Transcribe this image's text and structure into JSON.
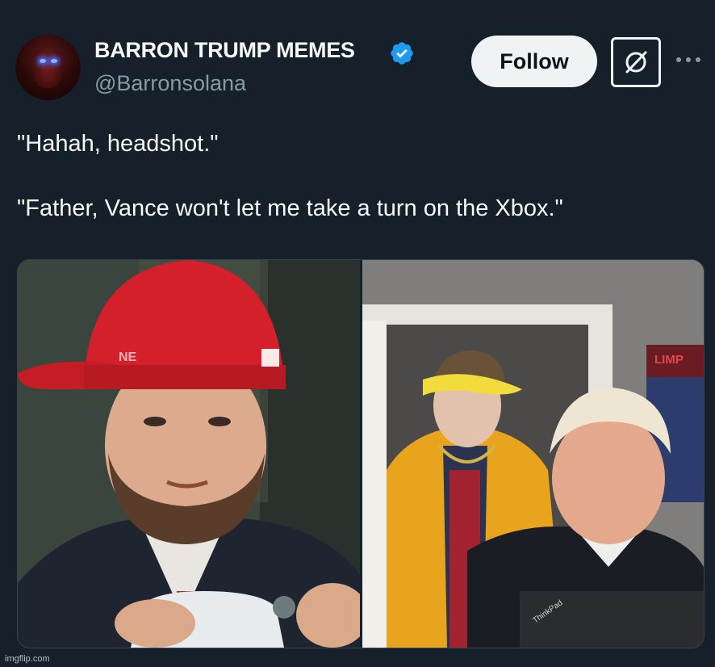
{
  "author": {
    "display_name": "BARRON TRUMP MEMES",
    "handle": "@Barronsolana",
    "verified": true
  },
  "actions": {
    "follow_label": "Follow"
  },
  "icons": {
    "verified": "verified-badge-icon",
    "grok": "grok-icon",
    "more": "more-dots-icon"
  },
  "tweet": {
    "line1": "\"Hahah, headshot.\"",
    "line2": "\"Father, Vance won't let me take a turn on the Xbox.\""
  },
  "media": {
    "laptop_brand": "ThinkPad",
    "poster_text": "LIMP"
  },
  "watermark": "imgflip.com",
  "colors": {
    "background": "#15202b",
    "verified_blue": "#1d9bf0",
    "secondary_text": "#8b98a5",
    "follow_bg": "#eff3f4"
  }
}
